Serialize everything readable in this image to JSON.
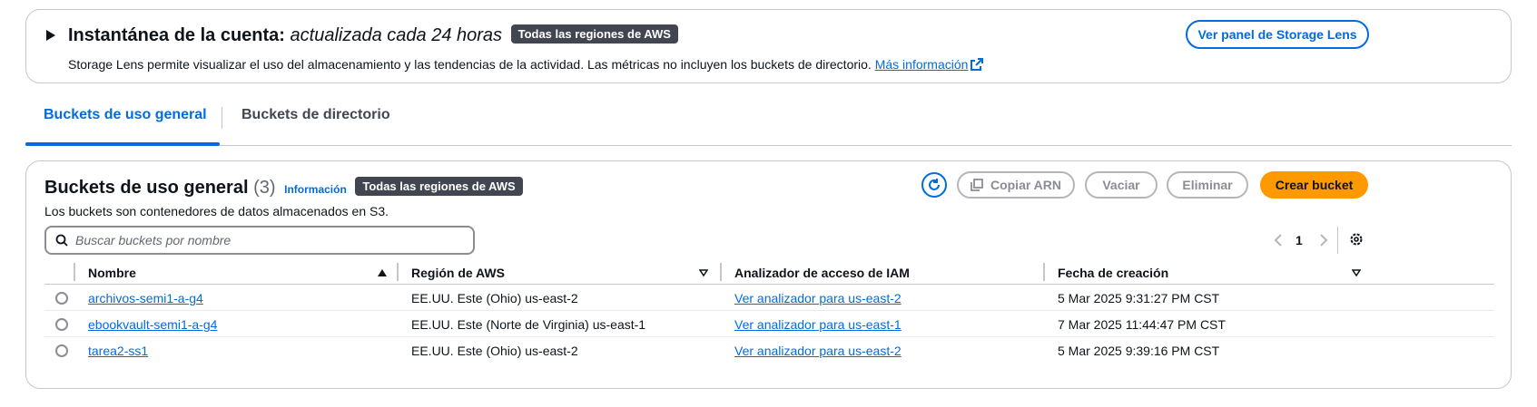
{
  "snapshot": {
    "title_bold": "Instantánea de la cuenta:",
    "title_italic": "actualizada cada 24 horas",
    "badge": "Todas las regiones de AWS",
    "description": "Storage Lens permite visualizar el uso del almacenamiento y las tendencias de la actividad. Las métricas no incluyen los buckets de directorio.",
    "more_info": "Más información",
    "storage_lens_button": "Ver panel de Storage Lens"
  },
  "tabs": [
    {
      "label": "Buckets de uso general"
    },
    {
      "label": "Buckets de directorio"
    }
  ],
  "panel": {
    "title": "Buckets de uso general",
    "count": "(3)",
    "info": "Información",
    "badge": "Todas las regiones de AWS",
    "description": "Los buckets son contenedores de datos almacenados en S3.",
    "copy_arn": "Copiar ARN",
    "empty": "Vaciar",
    "delete": "Eliminar",
    "create": "Crear bucket",
    "search_placeholder": "Buscar buckets por nombre",
    "page": "1"
  },
  "table": {
    "columns": [
      "Nombre",
      "Región de AWS",
      "Analizador de acceso de IAM",
      "Fecha de creación"
    ],
    "rows": [
      {
        "name": "archivos-semi1-a-g4",
        "region": "EE.UU. Este (Ohio) us-east-2",
        "analyzer": "Ver analizador para us-east-2",
        "date": "5 Mar 2025 9:31:27 PM CST"
      },
      {
        "name": "ebookvault-semi1-a-g4",
        "region": "EE.UU. Este (Norte de Virginia) us-east-1",
        "analyzer": "Ver analizador para us-east-1",
        "date": "7 Mar 2025 11:44:47 PM CST"
      },
      {
        "name": "tarea2-ss1",
        "region": "EE.UU. Este (Ohio) us-east-2",
        "analyzer": "Ver analizador para us-east-2",
        "date": "5 Mar 2025 9:39:16 PM CST"
      }
    ]
  },
  "colors": {
    "accent": "#006ce0",
    "primary_button": "#ff9900"
  }
}
